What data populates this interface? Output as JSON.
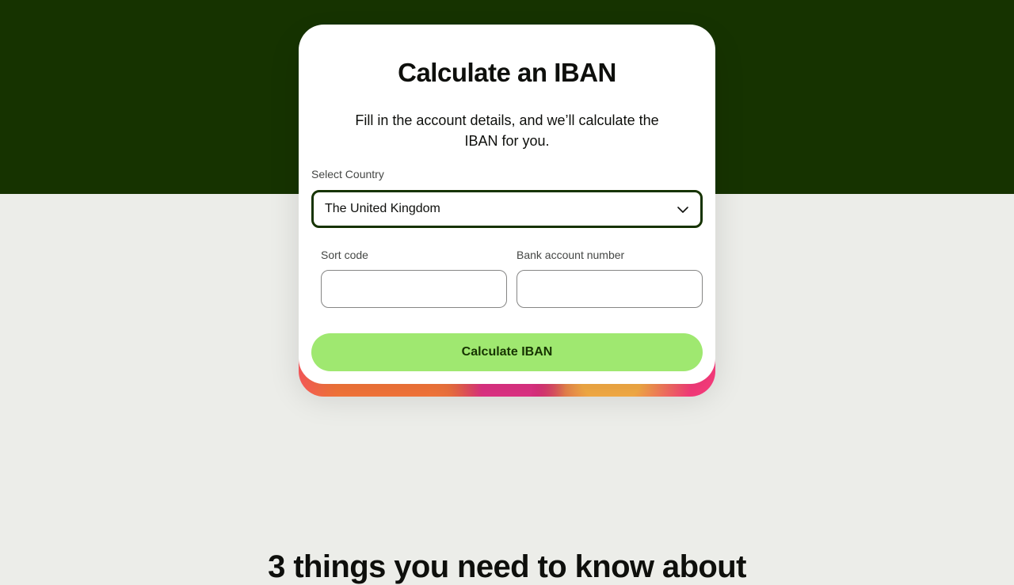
{
  "card": {
    "title": "Calculate an IBAN",
    "subtitle": "Fill in the account details, and we’ll calculate the IBAN for you."
  },
  "country": {
    "label": "Select Country",
    "value": "The United Kingdom",
    "icon": "chevron-down-icon"
  },
  "sort_code": {
    "label": "Sort code",
    "value": "",
    "placeholder": ""
  },
  "account_number": {
    "label": "Bank account number",
    "value": "",
    "placeholder": ""
  },
  "cta": {
    "label": "Calculate IBAN"
  },
  "section": {
    "heading": "3 things you need to know about"
  },
  "colors": {
    "hero_background": "#163300",
    "page_background": "#ecede9",
    "button_background": "#9fe870",
    "select_border": "#163300"
  }
}
